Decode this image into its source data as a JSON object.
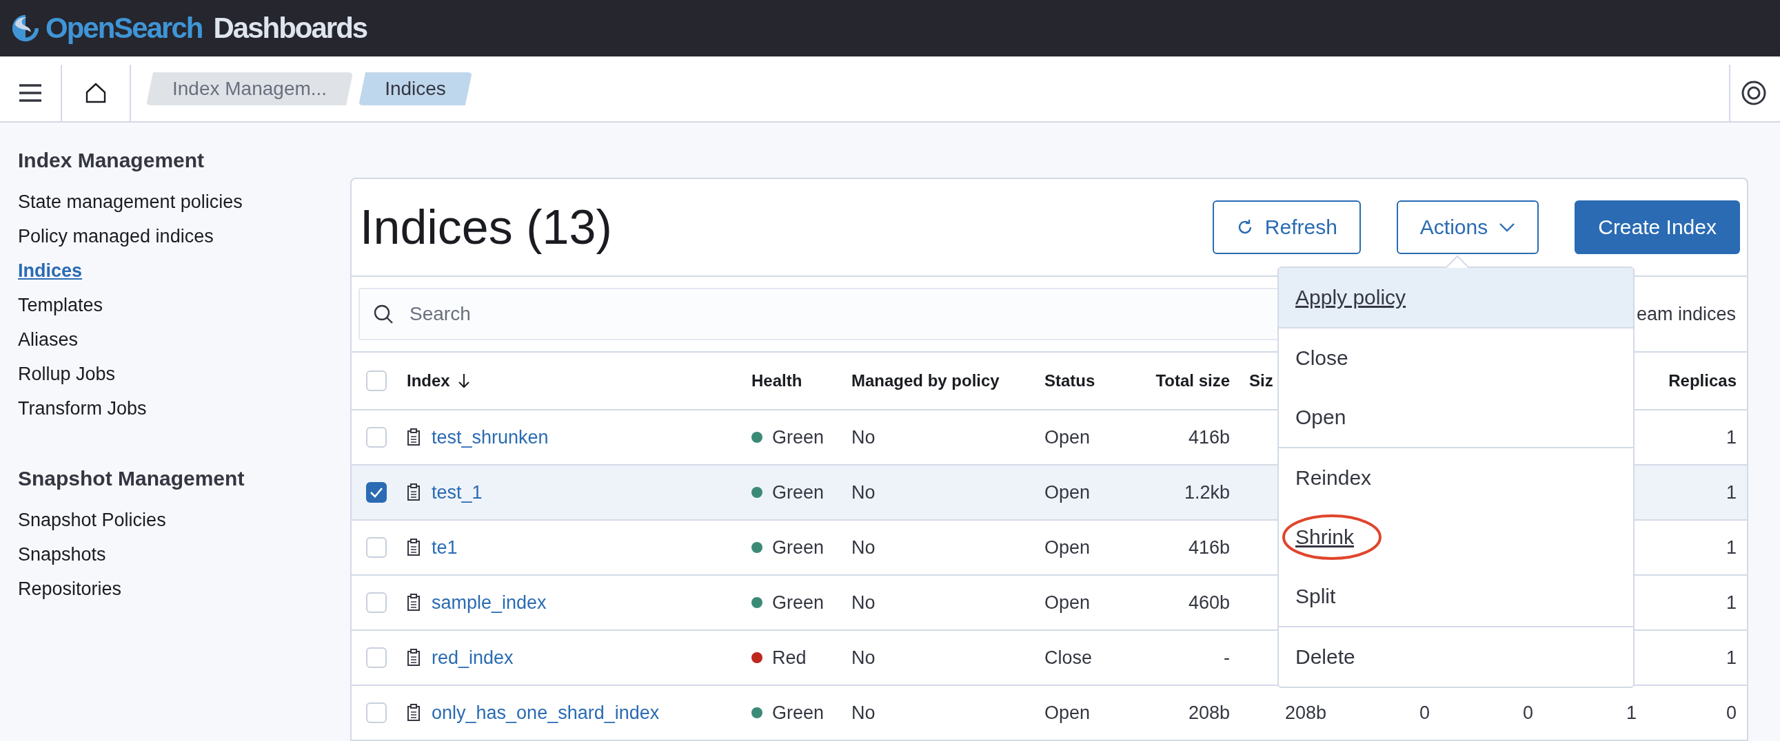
{
  "header": {
    "brand": "OpenSearch",
    "product": "Dashboards"
  },
  "breadcrumbs": [
    {
      "label": "Index Managem...",
      "selected": false
    },
    {
      "label": "Indices",
      "selected": true
    }
  ],
  "sidebar": {
    "sections": [
      {
        "title": "Index Management",
        "items": [
          {
            "label": "State management policies",
            "selected": false
          },
          {
            "label": "Policy managed indices",
            "selected": false
          },
          {
            "label": "Indices",
            "selected": true
          },
          {
            "label": "Templates",
            "selected": false
          },
          {
            "label": "Aliases",
            "selected": false
          },
          {
            "label": "Rollup Jobs",
            "selected": false
          },
          {
            "label": "Transform Jobs",
            "selected": false
          }
        ]
      },
      {
        "title": "Snapshot Management",
        "items": [
          {
            "label": "Snapshot Policies",
            "selected": false
          },
          {
            "label": "Snapshots",
            "selected": false
          },
          {
            "label": "Repositories",
            "selected": false
          }
        ]
      }
    ]
  },
  "panel": {
    "title": "Indices (13)",
    "buttons": [
      {
        "label": "Refresh",
        "kind": "refresh"
      },
      {
        "label": "Actions",
        "kind": "menu"
      },
      {
        "label": "Create Index",
        "kind": "primary"
      }
    ],
    "search": {
      "placeholder": "Search"
    },
    "toggle_label": "eam indices"
  },
  "table": {
    "select_all": {
      "checked": false
    },
    "columns": [
      {
        "label": "Index",
        "sorted": true
      },
      {
        "label": "Health",
        "sorted": false
      },
      {
        "label": "Managed by policy",
        "sorted": false
      },
      {
        "label": "Status",
        "sorted": false
      },
      {
        "label": "Total size",
        "sorted": false
      },
      {
        "label": "Siz",
        "sorted": false
      },
      {
        "label": "Replicas",
        "sorted": false
      }
    ],
    "rows": [
      {
        "selected": false,
        "color": "#3b8a78",
        "index": "test_shrunken",
        "health": "Green",
        "managed": "No",
        "status": "Open",
        "total_size": "416b",
        "replicas": "1"
      },
      {
        "selected": true,
        "color": "#3b8a78",
        "index": "test_1",
        "health": "Green",
        "managed": "No",
        "status": "Open",
        "total_size": "1.2kb",
        "replicas": "1"
      },
      {
        "selected": false,
        "color": "#3b8a78",
        "index": "te1",
        "health": "Green",
        "managed": "No",
        "status": "Open",
        "total_size": "416b",
        "replicas": "1"
      },
      {
        "selected": false,
        "color": "#3b8a78",
        "index": "sample_index",
        "health": "Green",
        "managed": "No",
        "status": "Open",
        "total_size": "460b",
        "replicas": "1"
      },
      {
        "selected": false,
        "color": "#bd271e",
        "index": "red_index",
        "health": "Red",
        "managed": "No",
        "status": "Close",
        "total_size": "-",
        "replicas": "1"
      },
      {
        "selected": false,
        "color": "#3b8a78",
        "index": "only_has_one_shard_index",
        "health": "Green",
        "managed": "No",
        "status": "Open",
        "total_size": "208b",
        "size": "208b",
        "column_7": "0",
        "column_8": "0",
        "column_9": "1",
        "replicas": "0"
      }
    ]
  },
  "menu": {
    "groups": [
      [
        {
          "label": "Apply policy",
          "highlighted": true,
          "underlined": true,
          "circled": false
        }
      ],
      [
        {
          "label": "Close",
          "highlighted": false,
          "underlined": false,
          "circled": false
        },
        {
          "label": "Open",
          "highlighted": false,
          "underlined": false,
          "circled": false
        }
      ],
      [
        {
          "label": "Reindex",
          "highlighted": false,
          "underlined": false,
          "circled": false
        },
        {
          "label": "Shrink",
          "highlighted": false,
          "underlined": true,
          "circled": true
        },
        {
          "label": "Split",
          "highlighted": false,
          "underlined": false,
          "circled": false
        }
      ],
      [
        {
          "label": "Delete",
          "highlighted": false,
          "underlined": false,
          "circled": false
        }
      ]
    ]
  }
}
